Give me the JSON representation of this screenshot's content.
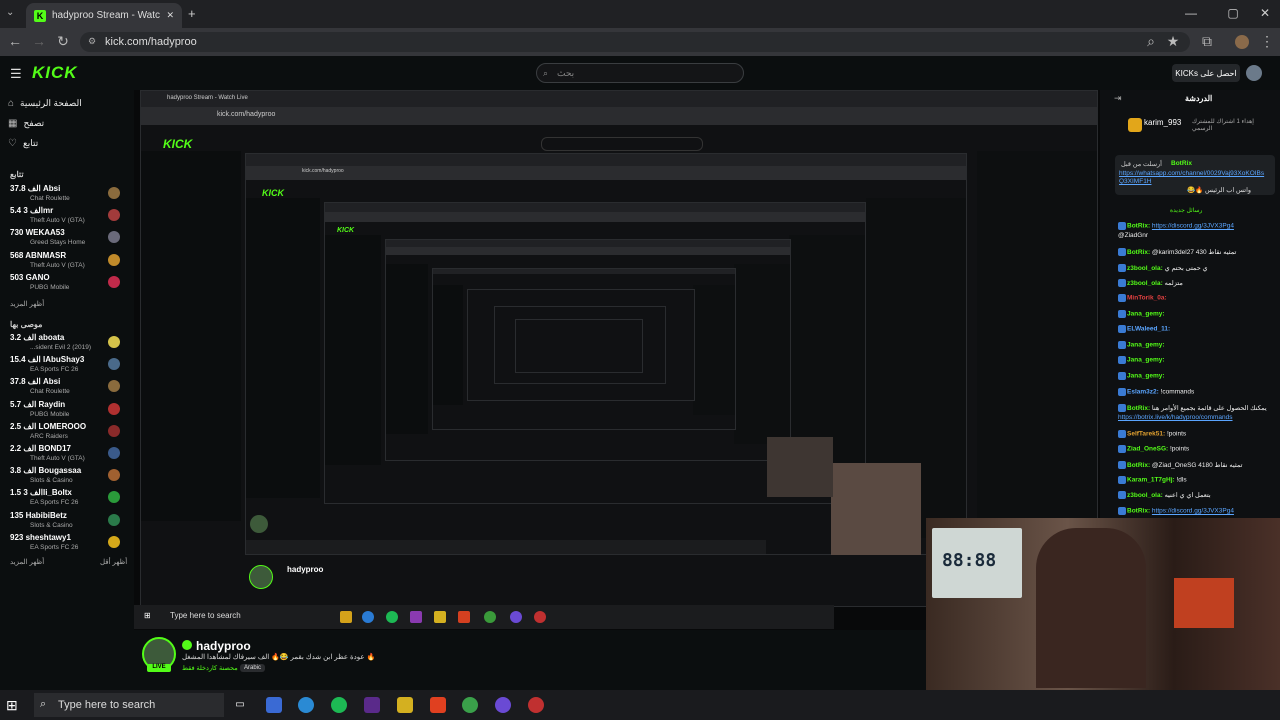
{
  "browser": {
    "tab_title": "hadyproo Stream - Watch Live",
    "url": "kick.com/hadyproo",
    "new_tab": "+",
    "win_controls": [
      "—",
      "▢",
      "✕"
    ]
  },
  "header": {
    "logo": "KICK",
    "search_placeholder": "بحث",
    "get_kicks": "KICKs احصل على"
  },
  "sidebar": {
    "nav": [
      "الصفحة الرئيسية",
      "تصفح",
      "تتابع"
    ],
    "following_title": "تتابع",
    "following": [
      {
        "count": "37.8 الف",
        "name": "Absi",
        "game": "Chat Roulette",
        "color": "#8a6b3d"
      },
      {
        "count": "5.4 الف",
        "name": "3mr",
        "game": "Theft Auto V (GTA)",
        "color": "#a23b3b"
      },
      {
        "count": "730",
        "name": "WEKAA53",
        "game": "Greed Stays Home",
        "color": "#6a6a7a"
      },
      {
        "count": "568",
        "name": "ABNMASR",
        "game": "Theft Auto V (GTA)",
        "color": "#c08a2a"
      },
      {
        "count": "503",
        "name": "GANO",
        "game": "PUBG Mobile",
        "color": "#c02a4a"
      }
    ],
    "show_more": "أظهر المزيد",
    "recommended_title": "موصى بها",
    "recommended": [
      {
        "count": "3.2 الف",
        "name": "aboata",
        "game": "...sident Evil 2 (2019)",
        "color": "#d4c24a"
      },
      {
        "count": "15.4 الف",
        "name": "IAbuShay3",
        "game": "EA Sports FC 26",
        "color": "#4a6a8a"
      },
      {
        "count": "37.8 الف",
        "name": "Absi",
        "game": "Chat Roulette",
        "color": "#8a6b3d"
      },
      {
        "count": "5.7 الف",
        "name": "Raydin",
        "game": "PUBG Mobile",
        "color": "#b03030"
      },
      {
        "count": "2.5 الف",
        "name": "LOMEROOO",
        "game": "ARC Raiders",
        "color": "#8a2a2a"
      },
      {
        "count": "2.2 الف",
        "name": "BOND17",
        "game": "Theft Auto V (GTA)",
        "color": "#3a5a8a"
      },
      {
        "count": "3.8 الف",
        "name": "Bougassaa",
        "game": "Slots & Casino",
        "color": "#a06030"
      },
      {
        "count": "1.5 الف",
        "name": "3li_Boltx",
        "game": "EA Sports FC 26",
        "color": "#2a9a3a"
      },
      {
        "count": "135",
        "name": "HabibiBetz",
        "game": "Slots & Casino",
        "color": "#2a7a4a"
      },
      {
        "count": "923",
        "name": "sheshtawy1",
        "game": "EA Sports FC 26",
        "color": "#d4a81a"
      }
    ],
    "show_more_2": "أظهر المزيد",
    "show_less": "أظهر أقل"
  },
  "streamer": {
    "name": "hadyproo",
    "title": "عودة عظر ابن شدك بقمر 😂🔥 الف سيرفاك لمشاهدا المشغل 🔥",
    "category": "محصنة كاردخلة فقط",
    "language": "Arabic",
    "live": "LIVE"
  },
  "chat": {
    "title": "الدردشة",
    "pinned_user": "karim_993",
    "pinned_text": "إهداء 1 اشتراك للمشترك الرسمي",
    "pinned_msg_user": "BotRix",
    "pinned_msg_prefix": "أرسلت من قبل",
    "pinned_link": "https://whatsapp.com/channel/0029Vaj93XoKOIBsQ3XIMF1H",
    "pinned_tail": "😂🔥 واتس اب الرئيس",
    "vip_label": "رسائل جديدة",
    "messages": [
      {
        "user": "BotRix",
        "color": "#53fc18",
        "text": "https://discord.gg/3JVX3Pg4",
        "link": true
      },
      {
        "user": "",
        "color": "#eee",
        "text": "@ZiadGnr",
        "link": false
      },
      {
        "user": "BotRix",
        "color": "#53fc18",
        "text": "@karim3del27 430 تمثيه نقاط",
        "link": false
      },
      {
        "user": "z3bool_ola",
        "color": "#53fc18",
        "text": "ي حمتى بحتم ي",
        "link": false
      },
      {
        "user": "z3bool_ola",
        "color": "#53fc18",
        "text": "متزلمه",
        "link": false
      },
      {
        "user": "MinTorik_0a",
        "color": "#e04040",
        "text": "",
        "link": false
      },
      {
        "user": "Jana_gemy",
        "color": "#53fc18",
        "text": "",
        "link": false
      },
      {
        "user": "ELWaleed_11",
        "color": "#5aa5ff",
        "text": "",
        "link": false
      },
      {
        "user": "Jana_gemy",
        "color": "#53fc18",
        "text": "",
        "link": false
      },
      {
        "user": "Jana_gemy",
        "color": "#53fc18",
        "text": "",
        "link": false
      },
      {
        "user": "Jana_gemy",
        "color": "#53fc18",
        "text": "",
        "link": false
      },
      {
        "user": "Eslam3z2",
        "color": "#5aa5ff",
        "text": "!commands",
        "link": false
      },
      {
        "user": "BotRix",
        "color": "#53fc18",
        "text": "يمكنك الحصول على قائمة بجميع الأوامر هنا",
        "link": false
      },
      {
        "user": "",
        "color": "#eee",
        "text": "https://botrix.live/k/hadyproo/commands",
        "link": true
      },
      {
        "user": "SelfTarek51",
        "color": "#e0a030",
        "text": "!points",
        "link": false
      },
      {
        "user": "Ziad_OneSG",
        "color": "#53fc18",
        "text": "!points",
        "link": false
      },
      {
        "user": "BotRix",
        "color": "#53fc18",
        "text": "@Ziad_OneSG 4180 تمثيه نقاط",
        "link": false
      },
      {
        "user": "Karam_1T7gHj",
        "color": "#53fc18",
        "text": "!dls",
        "link": false
      },
      {
        "user": "z3bool_ola",
        "color": "#53fc18",
        "text": "بتعمل اي ي اعنيه",
        "link": false
      },
      {
        "user": "BotRix",
        "color": "#53fc18",
        "text": "https://discord.gg/3JVX3Pg4",
        "link": true
      }
    ]
  },
  "taskbar": {
    "search_placeholder": "Type here to search",
    "nested_search": "Type here to search"
  }
}
